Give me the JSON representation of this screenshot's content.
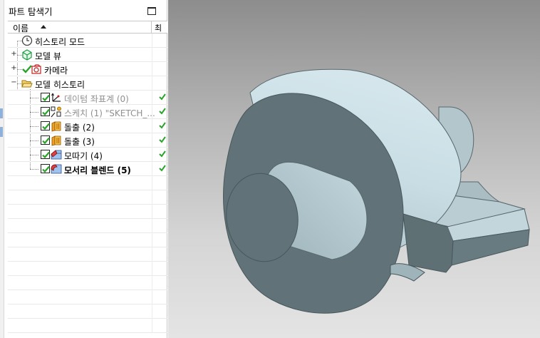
{
  "navigator": {
    "title": "파트 탐색기",
    "header": {
      "name_label": "이름",
      "status_label": "최"
    },
    "items": [
      {
        "label": "히스토리 모드",
        "style": "normal",
        "icon": "clock-icon"
      },
      {
        "label": "모델 뷰",
        "style": "normal",
        "icon": "model-views-icon"
      },
      {
        "label": "카메라",
        "style": "normal",
        "icon": "camera-icon"
      },
      {
        "label": "모델 히스토리",
        "style": "normal",
        "icon": "folder-open-icon"
      },
      {
        "label": "데이텀 좌표계 (0)",
        "style": "dim",
        "icon": "datum-csys-icon"
      },
      {
        "label": "스케치 (1) \"SKETCH_...",
        "style": "dim",
        "icon": "sketch-icon"
      },
      {
        "label": "돌출 (2)",
        "style": "normal",
        "icon": "extrude-icon"
      },
      {
        "label": "돌출 (3)",
        "style": "normal",
        "icon": "extrude-icon"
      },
      {
        "label": "모따기 (4)",
        "style": "normal",
        "icon": "chamfer-icon"
      },
      {
        "label": "모서리 블렌드 (5)",
        "style": "bold",
        "icon": "edge-blend-icon"
      }
    ]
  },
  "colors": {
    "part_light": "#c8dde4",
    "part_mid": "#b4c8ce",
    "part_dark": "#617378",
    "check_green": "#2aa32a"
  }
}
